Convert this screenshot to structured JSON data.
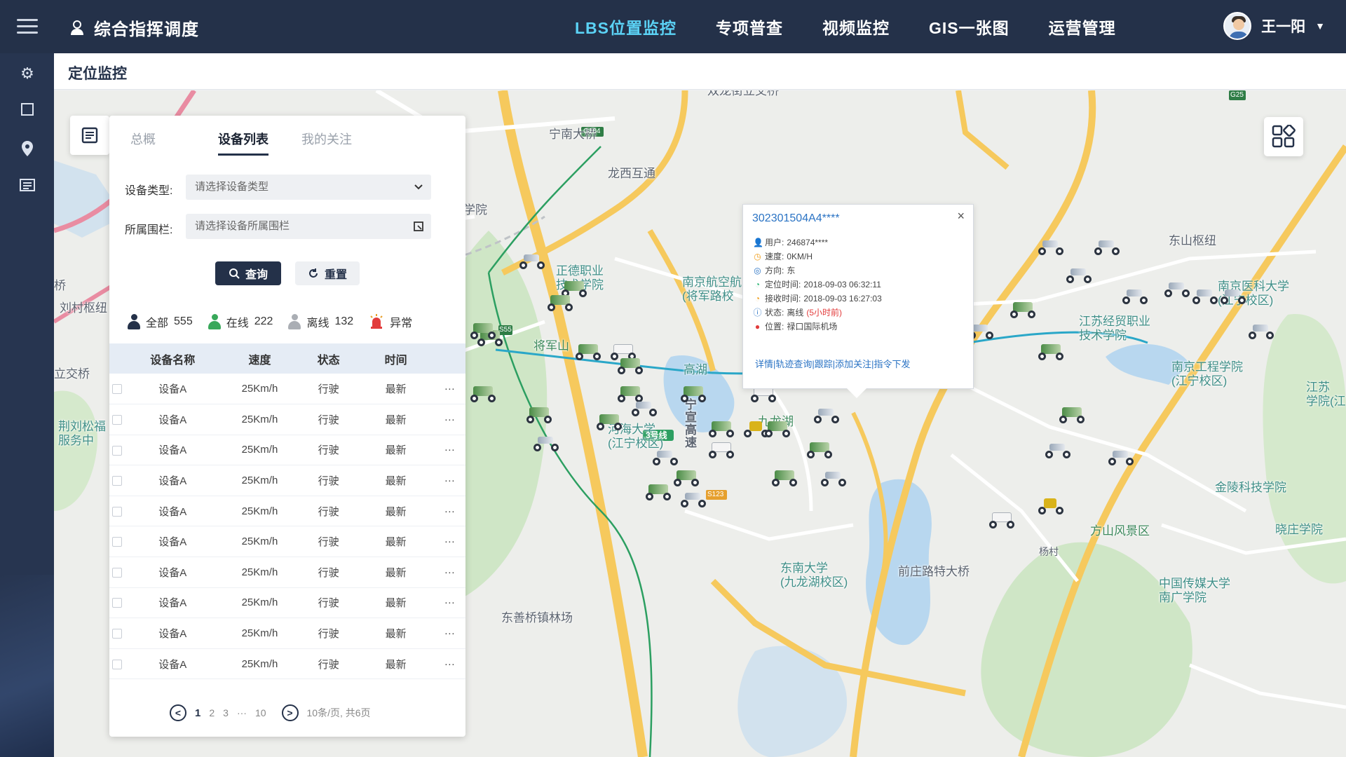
{
  "app": {
    "title": "综合指挥调度"
  },
  "nav": [
    {
      "label": "LBS位置监控",
      "active": true
    },
    {
      "label": "专项普查"
    },
    {
      "label": "视频监控"
    },
    {
      "label": "GIS一张图"
    },
    {
      "label": "运营管理"
    }
  ],
  "user": {
    "name": "王一阳"
  },
  "sidebar": {
    "icons": [
      "gear-icon",
      "square-icon",
      "location-pin-icon",
      "list-icon"
    ]
  },
  "page": {
    "title": "定位监控"
  },
  "panel": {
    "tabs": [
      "总概",
      "设备列表",
      "我的关注"
    ],
    "active_tab": "设备列表",
    "device_type_label": "设备类型:",
    "device_type_placeholder": "请选择设备类型",
    "fence_label": "所属围栏:",
    "fence_placeholder": "请选择设备所属围栏",
    "query_label": "查询",
    "reset_label": "重置",
    "stats": [
      {
        "label": "全部",
        "value": "555"
      },
      {
        "label": "在线",
        "value": "222"
      },
      {
        "label": "离线",
        "value": "132"
      },
      {
        "label": "异常",
        "value": ""
      }
    ],
    "table": {
      "headers": [
        "设备名称",
        "速度",
        "状态",
        "时间"
      ],
      "rows": [
        {
          "name": "设备A",
          "speed": "25Km/h",
          "status": "行驶",
          "time": "最新"
        },
        {
          "name": "设备A",
          "speed": "25Km/h",
          "status": "行驶",
          "time": "最新"
        },
        {
          "name": "设备A",
          "speed": "25Km/h",
          "status": "行驶",
          "time": "最新"
        },
        {
          "name": "设备A",
          "speed": "25Km/h",
          "status": "行驶",
          "time": "最新"
        },
        {
          "name": "设备A",
          "speed": "25Km/h",
          "status": "行驶",
          "time": "最新"
        },
        {
          "name": "设备A",
          "speed": "25Km/h",
          "status": "行驶",
          "time": "最新"
        },
        {
          "name": "设备A",
          "speed": "25Km/h",
          "status": "行驶",
          "time": "最新"
        },
        {
          "name": "设备A",
          "speed": "25Km/h",
          "status": "行驶",
          "time": "最新"
        },
        {
          "name": "设备A",
          "speed": "25Km/h",
          "status": "行驶",
          "time": "最新"
        },
        {
          "name": "设备A",
          "speed": "25Km/h",
          "status": "行驶",
          "time": "最新"
        }
      ],
      "more": "···"
    },
    "pager": {
      "pages": [
        "1",
        "2",
        "3",
        "···",
        "10"
      ],
      "current": "1",
      "info": "10条/页, 共6页"
    }
  },
  "popup": {
    "id": "302301504A4****",
    "user_label": "用户:",
    "user": "246874****",
    "speed_label": "速度:",
    "speed": "0KM/H",
    "direction_label": "方向:",
    "direction": "东",
    "locate_time_label": "定位时间:",
    "locate_time": "2018-09-03 06:32:11",
    "receive_time_label": "接收时间:",
    "receive_time": "2018-09-03 16:27:03",
    "status_label": "状态:",
    "status": "离线",
    "status_note": "(5小时前)",
    "position_label": "位置:",
    "position": "禄口国际机场",
    "actions": "详情|轨迹查询|跟踪|添加关注|指令下发"
  },
  "map": {
    "labels": [
      {
        "text": "双龙街立交桥",
        "kind": "road"
      },
      {
        "text": "宁南大桥",
        "kind": "road"
      },
      {
        "text": "龙西互通",
        "kind": "road"
      },
      {
        "text": "东山枢纽",
        "kind": "road"
      },
      {
        "text": "正德职业\n技术学院",
        "kind": "school"
      },
      {
        "text": "南京航空航\n(将军路校",
        "kind": "school"
      },
      {
        "text": "将军山",
        "kind": "park"
      },
      {
        "text": "高湖",
        "kind": "water"
      },
      {
        "text": "九龙湖",
        "kind": "park"
      },
      {
        "text": "河海大学\n(江宁校区)",
        "kind": "school"
      },
      {
        "text": "宁\n宣\n高\n速",
        "kind": "road"
      },
      {
        "text": "江苏经贸职业\n技术学院",
        "kind": "school"
      },
      {
        "text": "南京医科大学\n(江宁校区)",
        "kind": "school"
      },
      {
        "text": "南京工程学院\n(江宁校区)",
        "kind": "school"
      },
      {
        "text": "江苏\n学院(江",
        "kind": "school"
      },
      {
        "text": "金陵科技学院",
        "kind": "school"
      },
      {
        "text": "方山风景区",
        "kind": "park"
      },
      {
        "text": "晓庄学院",
        "kind": "school"
      },
      {
        "text": "杨村",
        "kind": "place"
      },
      {
        "text": "东南大学\n(九龙湖校区)",
        "kind": "school"
      },
      {
        "text": "前庄路特大桥",
        "kind": "road"
      },
      {
        "text": "中国传媒大学\n南广学院",
        "kind": "school"
      },
      {
        "text": "东善桥镇林场",
        "kind": "place"
      },
      {
        "text": "刘村枢纽",
        "kind": "road"
      },
      {
        "text": "立交桥",
        "kind": "road"
      },
      {
        "text": "荆刘松福\n服务中",
        "kind": "place"
      },
      {
        "text": "桥",
        "kind": "road"
      },
      {
        "text": "学院",
        "kind": "school"
      },
      {
        "text": "G104",
        "kind": "shield"
      },
      {
        "text": "G25",
        "kind": "shield"
      },
      {
        "text": "S55",
        "kind": "shield"
      },
      {
        "text": "S123",
        "kind": "shield"
      },
      {
        "text": "3号线",
        "kind": "metro"
      }
    ]
  }
}
